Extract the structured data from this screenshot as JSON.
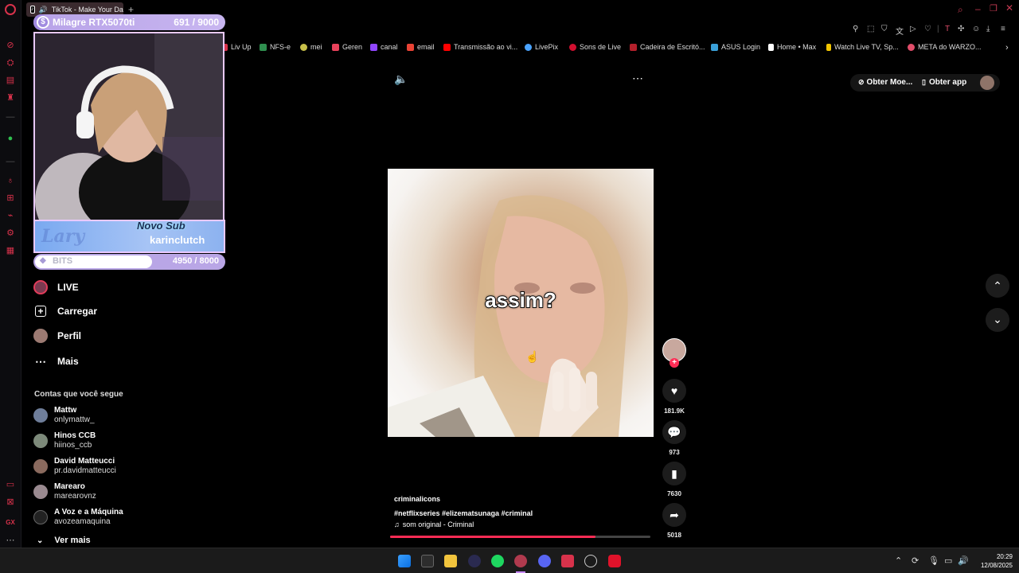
{
  "browser": {
    "tab_title": "TikTok - Make Your Day",
    "new_tab": "+",
    "bookmarks": [
      {
        "label": "Liv Up",
        "color": "#d8324b"
      },
      {
        "label": "NFS-e",
        "color": "#2f8f4f"
      },
      {
        "label": "mei",
        "color": "#c8c04a"
      },
      {
        "label": "Geren",
        "color": "#e9425b"
      },
      {
        "label": "canal",
        "color": "#9146ff"
      },
      {
        "label": "email",
        "color": "#ea4335"
      },
      {
        "label": "Transmissão ao vi...",
        "color": "#ff0000"
      },
      {
        "label": "LivePix",
        "color": "#4aa3ff"
      },
      {
        "label": "Sons de Live",
        "color": "#d10f2f"
      },
      {
        "label": "Cadeira de Escritó...",
        "color": "#b3202b"
      },
      {
        "label": "ASUS Login",
        "color": "#3aa0d8"
      },
      {
        "label": "Home • Max",
        "color": "#ffffff"
      },
      {
        "label": "Watch Live TV, Sp...",
        "color": "#f2c500"
      },
      {
        "label": "META do WARZO...",
        "color": "#e14d6a"
      }
    ]
  },
  "overlay": {
    "goal_label": "Milagre RTX5070ti",
    "goal_progress": "691 / 9000",
    "goal_fraction": 0.077,
    "sub_title": "Novo Sub",
    "sub_user": "karinclutch",
    "sub_logo": "Lary",
    "bits_label": "BITS",
    "bits_progress": "4950 / 8000",
    "bits_fraction": 0.62
  },
  "tiktok": {
    "nav": [
      {
        "label": "LIVE",
        "icon": "live-icon"
      },
      {
        "label": "Carregar",
        "icon": "upload-icon"
      },
      {
        "label": "Perfil",
        "icon": "profile-icon"
      },
      {
        "label": "Mais",
        "icon": "more-icon"
      }
    ],
    "following_title": "Contas que você segue",
    "following": [
      {
        "name": "Mattw",
        "user": "onlymattw_"
      },
      {
        "name": "Hinos CCB",
        "user": "hiinos_ccb"
      },
      {
        "name": "David Matteucci",
        "user": "pr.davidmatteucci"
      },
      {
        "name": "Marearo",
        "user": "marearovnz"
      },
      {
        "name": "A Voz e a Máquina",
        "user": "avozeamaquina"
      }
    ],
    "see_more": "Ver mais",
    "header": {
      "get_coins": "Obter Moe...",
      "get_app": "Obter app"
    },
    "video": {
      "caption_overlay": "assim?",
      "author": "criminalicons",
      "hashtags": "#netflixseries #elizematsunaga #criminal",
      "sound": "som original - Criminal",
      "progress": 0.79
    },
    "actions": [
      {
        "name": "like",
        "count": "181.9K"
      },
      {
        "name": "comment",
        "count": "973"
      },
      {
        "name": "save",
        "count": "7630"
      },
      {
        "name": "share",
        "count": "5018"
      }
    ]
  },
  "taskbar": {
    "time": "20:29",
    "date": "12/08/2025"
  }
}
